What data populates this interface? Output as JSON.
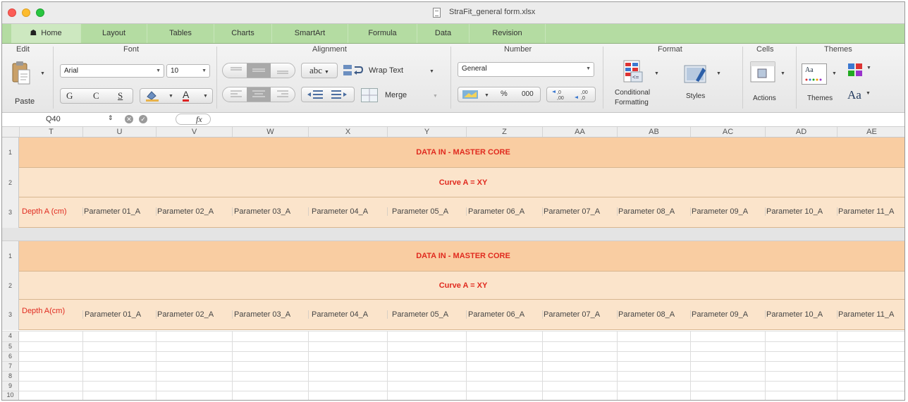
{
  "window": {
    "title": "StraFit_general form.xlsx"
  },
  "tabs": [
    {
      "label": "Home",
      "icon": "home-icon"
    },
    {
      "label": "Layout"
    },
    {
      "label": "Tables"
    },
    {
      "label": "Charts"
    },
    {
      "label": "SmartArt"
    },
    {
      "label": "Formula"
    },
    {
      "label": "Data"
    },
    {
      "label": "Revision"
    }
  ],
  "ribbon": {
    "edit": {
      "title": "Edit",
      "paste": "Paste"
    },
    "font": {
      "title": "Font",
      "family": "Arial",
      "size": "10",
      "bold": "G",
      "italic": "C",
      "underline": "S",
      "font_color_letter": "A"
    },
    "alignment": {
      "title": "Alignment",
      "wrap_text": "Wrap Text",
      "merge": "Merge",
      "abc": "abc"
    },
    "number": {
      "title": "Number",
      "format": "General",
      "percent": "%",
      "thousands": "000"
    },
    "format": {
      "title": "Format",
      "conditional": "Conditional",
      "formatting": "Formatting",
      "styles": "Styles"
    },
    "cells": {
      "title": "Cells",
      "actions": "Actions"
    },
    "themes": {
      "title": "Themes",
      "themes_label": "Themes",
      "aa_big": "Aa",
      "aa_small": "Aa"
    }
  },
  "formula_bar": {
    "cell_ref": "Q40",
    "fx": "fx"
  },
  "columns": [
    "T",
    "U",
    "V",
    "W",
    "X",
    "Y",
    "Z",
    "AA",
    "AB",
    "AC",
    "AD",
    "AE"
  ],
  "sections": [
    {
      "rows": [
        "1",
        "2",
        "3"
      ],
      "master_title": "DATA IN - MASTER CORE",
      "curve": "Curve A = XY",
      "depth": "Depth A (cm)",
      "params": [
        "Parameter 01_A",
        "Parameter 02_A",
        "Parameter 03_A",
        "Parameter 04_A",
        "Parameter 05_A",
        "Parameter 06_A",
        "Parameter 07_A",
        "Parameter 08_A",
        "Parameter 09_A",
        "Parameter 10_A",
        "Parameter 11_A"
      ]
    },
    {
      "rows": [
        "1",
        "2",
        "3"
      ],
      "master_title": "DATA IN - MASTER CORE",
      "curve": "Curve A = XY",
      "depth": "Depth A(cm)",
      "params": [
        "Parameter 01_A",
        "Parameter 02_A",
        "Parameter 03_A",
        "Parameter 04_A",
        "Parameter 05_A",
        "Parameter 06_A",
        "Parameter 07_A",
        "Parameter 08_A",
        "Parameter 09_A",
        "Parameter 10_A",
        "Parameter 11_A"
      ]
    }
  ],
  "empty_rows": [
    "4",
    "5",
    "6",
    "7",
    "8",
    "9",
    "10"
  ],
  "colors": {
    "band_dark": "#f9cda2",
    "band_light": "#fbe4cb",
    "header_text": "#e02a1f",
    "tab_bar": "#b4dca2"
  }
}
